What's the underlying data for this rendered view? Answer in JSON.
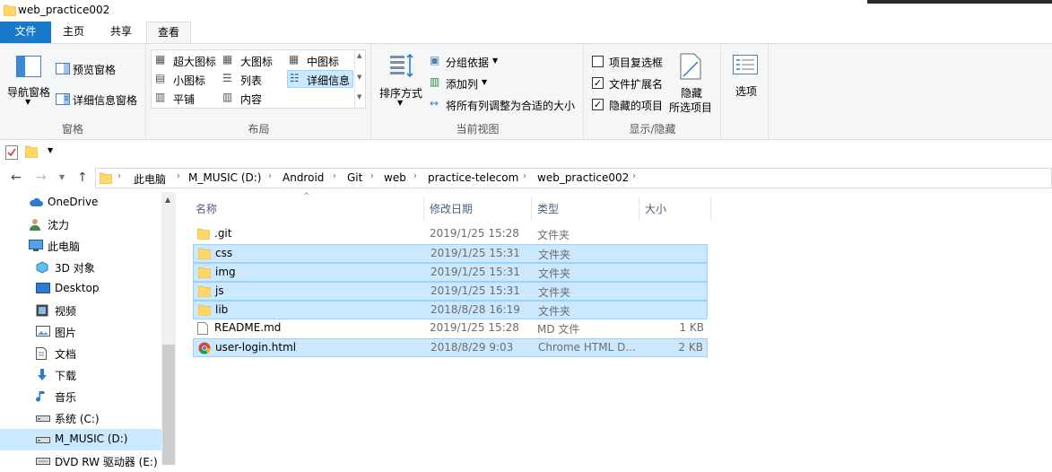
{
  "window": {
    "title": "web_practice002"
  },
  "ribbon_tabs": [
    "文件",
    "主页",
    "共享",
    "查看"
  ],
  "ribbon": {
    "panes": {
      "nav_pane": "导航窗格",
      "preview_pane": "预览窗格",
      "details_pane": "详细信息窗格",
      "label": "窗格"
    },
    "layout": {
      "extra_large": "超大图标",
      "large": "大图标",
      "medium": "中图标",
      "small": "小图标",
      "list": "列表",
      "details": "详细信息",
      "tiles": "平铺",
      "content": "内容",
      "label": "布局"
    },
    "current_view": {
      "sort_by": "排序方式",
      "group_by": "分组依据",
      "add_columns": "添加列",
      "fit_columns": "将所有列调整为合适的大小",
      "label": "当前视图"
    },
    "show_hide": {
      "item_checkboxes": "项目复选框",
      "item_checkboxes_checked": false,
      "file_extensions": "文件扩展名",
      "file_extensions_checked": true,
      "hidden_items": "隐藏的项目",
      "hidden_items_checked": true,
      "hide_selected_l1": "隐藏",
      "hide_selected_l2": "所选项目",
      "label": "显示/隐藏"
    },
    "options": "选项"
  },
  "breadcrumb": [
    "此电脑",
    "M_MUSIC (D:)",
    "Android",
    "Git",
    "web",
    "practice-telecom",
    "web_practice002"
  ],
  "sidebar": [
    {
      "label": "OneDrive",
      "icon": "cloud-icon"
    },
    {
      "label": "沈力",
      "icon": "user-icon"
    },
    {
      "label": "此电脑",
      "icon": "computer-icon"
    },
    {
      "label": "3D 对象",
      "icon": "cube-icon"
    },
    {
      "label": "Desktop",
      "icon": "desktop-icon"
    },
    {
      "label": "视频",
      "icon": "video-icon"
    },
    {
      "label": "图片",
      "icon": "picture-icon"
    },
    {
      "label": "文档",
      "icon": "document-icon"
    },
    {
      "label": "下载",
      "icon": "download-icon"
    },
    {
      "label": "音乐",
      "icon": "music-icon"
    },
    {
      "label": "系统 (C:)",
      "icon": "drive-icon"
    },
    {
      "label": "M_MUSIC (D:)",
      "icon": "drive-icon"
    },
    {
      "label": "DVD RW 驱动器 (E:)",
      "icon": "dvd-icon"
    }
  ],
  "columns": [
    "名称",
    "修改日期",
    "类型",
    "大小"
  ],
  "files": [
    {
      "name": ".git",
      "date": "2019/1/25 15:28",
      "type": "文件夹",
      "size": "",
      "kind": "folder"
    },
    {
      "name": "css",
      "date": "2019/1/25 15:31",
      "type": "文件夹",
      "size": "",
      "kind": "folder"
    },
    {
      "name": "img",
      "date": "2019/1/25 15:31",
      "type": "文件夹",
      "size": "",
      "kind": "folder"
    },
    {
      "name": "js",
      "date": "2019/1/25 15:31",
      "type": "文件夹",
      "size": "",
      "kind": "folder"
    },
    {
      "name": "lib",
      "date": "2018/8/28 16:19",
      "type": "文件夹",
      "size": "",
      "kind": "folder"
    },
    {
      "name": "README.md",
      "date": "2019/1/25 15:28",
      "type": "MD 文件",
      "size": "1 KB",
      "kind": "file"
    },
    {
      "name": "user-login.html",
      "date": "2018/8/29 9:03",
      "type": "Chrome HTML D...",
      "size": "2 KB",
      "kind": "chrome"
    }
  ],
  "colors": {
    "accent": "#1979ca",
    "selection": "#cce8ff",
    "folder": "#ffd766"
  }
}
